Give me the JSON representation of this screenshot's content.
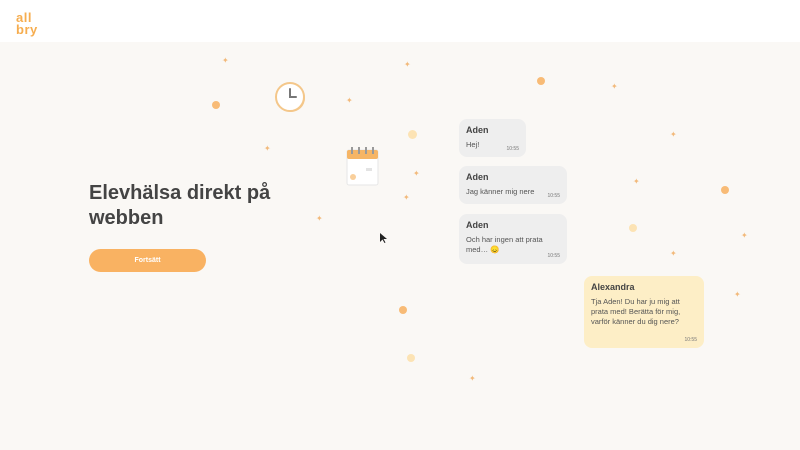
{
  "brand": {
    "line1": "all",
    "line2": "bry"
  },
  "hero": {
    "title": "Elevhälsa direkt på webben",
    "cta_label": "Fortsätt"
  },
  "chat": [
    {
      "name": "Aden",
      "text": "Hej!",
      "time": "10:55"
    },
    {
      "name": "Aden",
      "text": "Jag känner mig nere",
      "time": "10:55"
    },
    {
      "name": "Aden",
      "text": "Och har ingen att prata med… 😞",
      "time": "10:55"
    },
    {
      "name": "Alexandra",
      "text": "Tja Aden! Du har ju mig att prata med! Berätta för mig, varför känner du dig nere?",
      "time": "10:55"
    }
  ],
  "colors": {
    "accent": "#f9b262",
    "bubble_other": "#eeeeee",
    "bubble_me": "#fdeec6",
    "background": "#faf8f5"
  },
  "icons": [
    "clock-icon",
    "calendar-icon",
    "cursor-icon"
  ]
}
